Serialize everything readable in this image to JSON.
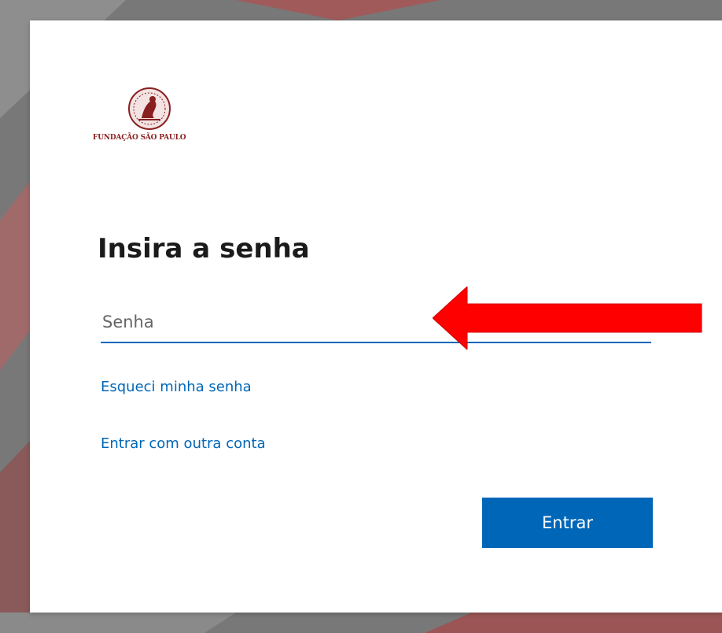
{
  "branding": {
    "logo_text": "FUNDAÇÃO SÃO PAULO",
    "logo_icon": "institution-seal-icon",
    "brand_color": "#8a1f1f"
  },
  "signin": {
    "title": "Insira a senha",
    "password_placeholder": "Senha",
    "password_value": "",
    "forgot_password_link": "Esqueci minha senha",
    "other_account_link": "Entrar com outra conta",
    "submit_label": "Entrar"
  },
  "colors": {
    "accent": "#0067b8",
    "annotation_arrow": "#ff0000",
    "background": "#7b7b7b"
  },
  "annotation": {
    "icon": "red-arrow-left-icon"
  }
}
